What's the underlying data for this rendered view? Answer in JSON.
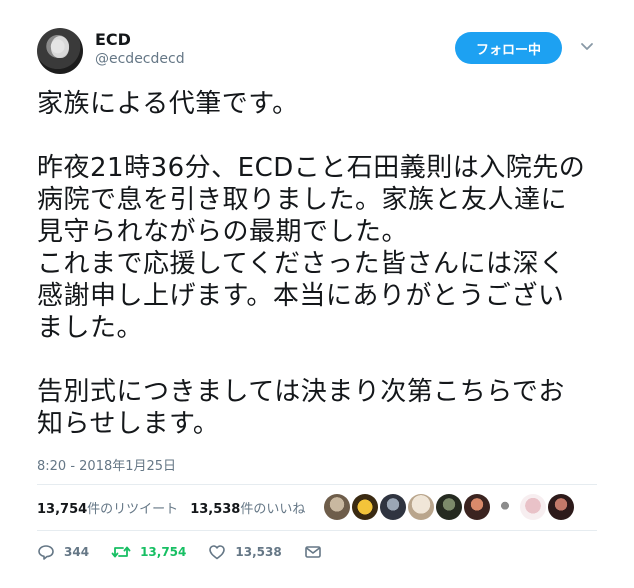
{
  "author": {
    "name": "ECD",
    "handle": "@ecdecdecd"
  },
  "follow_button": "フォロー中",
  "tweet": {
    "lines": [
      "家族による代筆です。",
      "",
      "昨夜21時36分、ECDこと石田義則は入院先の",
      "病院で息を引き取りました。家族と友人達に",
      "見守られながらの最期でした。",
      "これまで応援してくださった皆さんには深く",
      "感謝申し上げます。本当にありがとうござい",
      "ました。",
      "",
      "告別式につきましては決まり次第こちらでお",
      "知らせします。"
    ]
  },
  "timestamp": "8:20 - 2018年1月25日",
  "stats": {
    "retweets_count": "13,754",
    "retweets_label": "件のリツイート",
    "likes_count": "13,538",
    "likes_label": "件のいいね"
  },
  "actions": {
    "reply_count": "344",
    "retweet_count": "13,754",
    "like_count": "13,538"
  },
  "colors": {
    "accent": "#1da1f2",
    "retweet": "#17bf63",
    "muted": "#657786"
  },
  "icons": [
    "reply-icon",
    "retweet-icon",
    "like-icon",
    "message-icon",
    "chevron-down-icon"
  ]
}
